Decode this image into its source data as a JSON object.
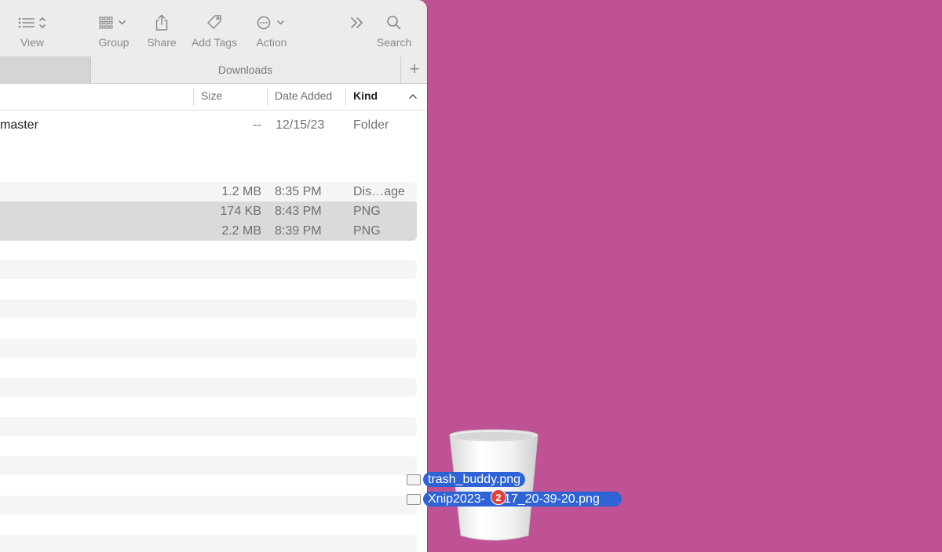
{
  "toolbar": {
    "view_label": "View",
    "group_label": "Group",
    "share_label": "Share",
    "add_tags_label": "Add Tags",
    "action_label": "Action",
    "search_label": "Search"
  },
  "tabs": {
    "active_label": "Downloads",
    "plus_label": "+"
  },
  "columns": {
    "size": "Size",
    "date_added": "Date Added",
    "kind": "Kind"
  },
  "rows": [
    {
      "name": "master",
      "size": "--",
      "date": "12/15/23",
      "kind": "Folder"
    },
    {
      "name": "",
      "size": "1.2 MB",
      "date": "8:35 PM",
      "kind": "Dis…age"
    },
    {
      "name": "",
      "size": "174 KB",
      "date": "8:43 PM",
      "kind": "PNG"
    },
    {
      "name": "",
      "size": "2.2 MB",
      "date": "8:39 PM",
      "kind": "PNG"
    }
  ],
  "drag": {
    "item1": "trash_buddy.png",
    "item2": "Xnip2023-",
    "item2_tail": "17_20-39-20.png",
    "count_badge": "2"
  },
  "colors": {
    "desktop": "#be5295",
    "selection": "#2e63d6",
    "badge": "#e0413a"
  }
}
